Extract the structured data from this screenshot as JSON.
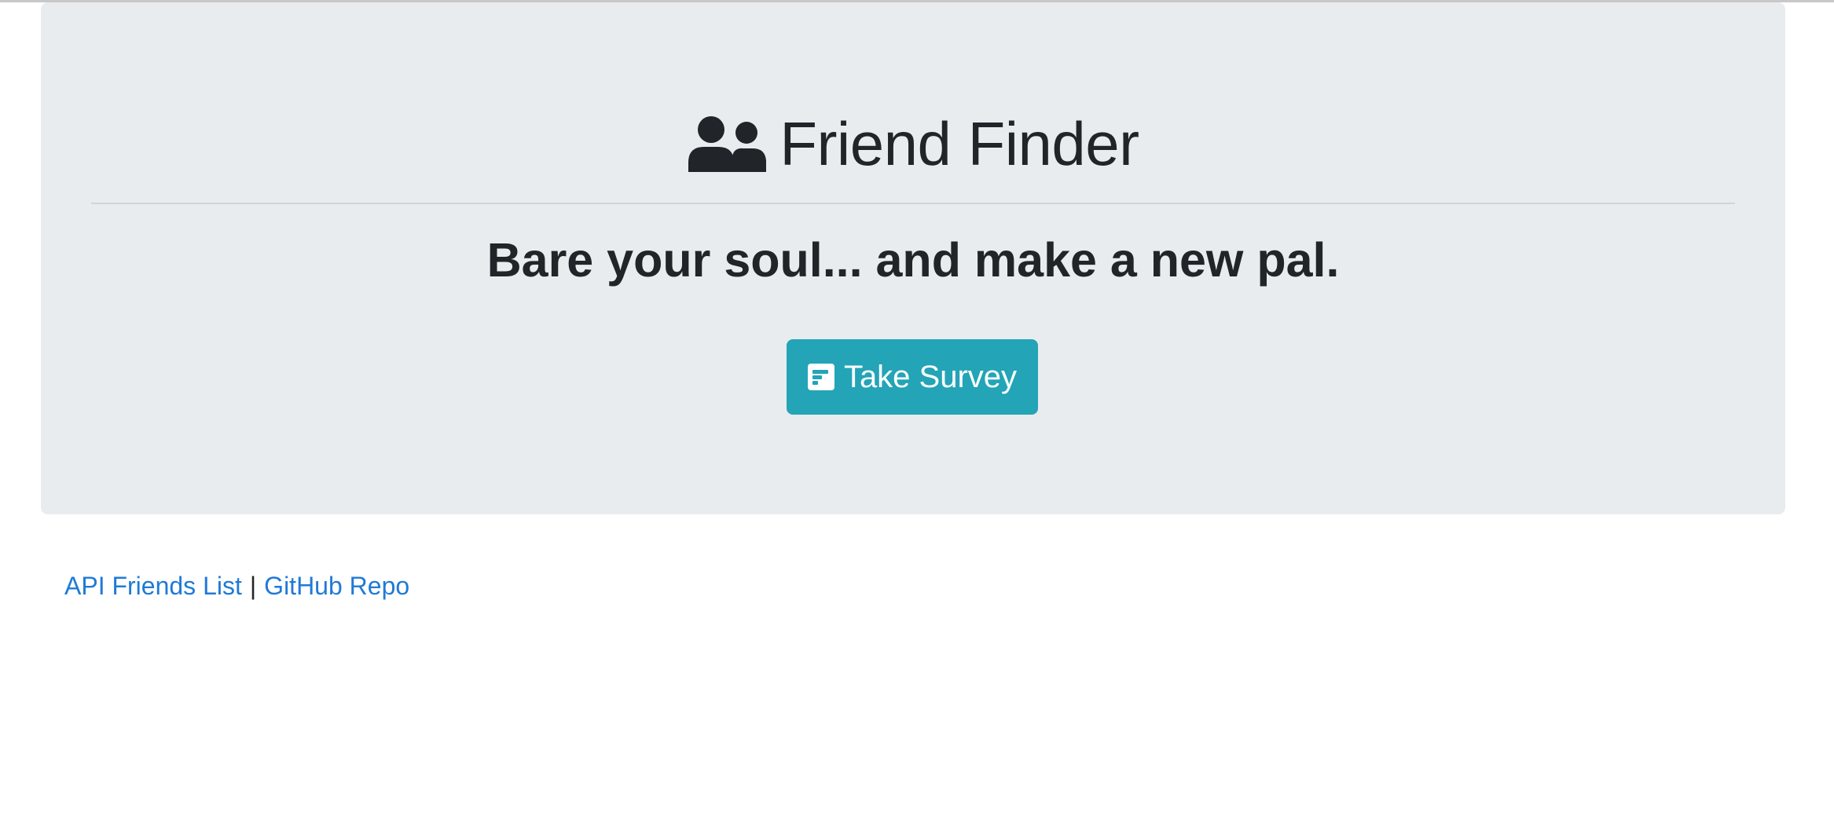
{
  "header": {
    "title": "Friend Finder",
    "icon": "users-icon"
  },
  "hero": {
    "subtitle": "Bare your soul... and make a new pal.",
    "survey_button": {
      "label": "Take Survey",
      "icon": "poll-icon",
      "color": "#23a4b7"
    }
  },
  "footer": {
    "links": [
      {
        "label": "API Friends List"
      },
      {
        "label": "GitHub Repo"
      }
    ],
    "separator": "|"
  },
  "colors": {
    "jumbotron_bg": "#e9ecef",
    "link": "#1f7ad6",
    "text": "#212529"
  }
}
